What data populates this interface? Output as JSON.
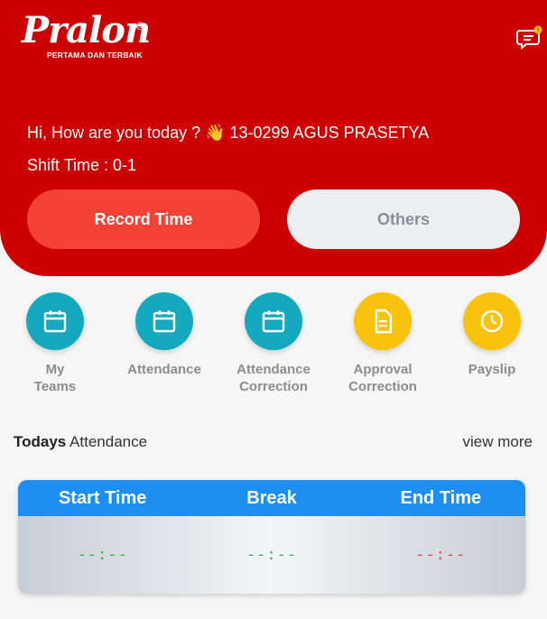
{
  "brand": {
    "name": "Pralon",
    "registered": "®",
    "tagline": "PERTAMA DAN TERBAIK"
  },
  "header": {
    "greeting": "Hi, How are you today ? 👋 13-0299 AGUS PRASETYA",
    "shift": "Shift Time : 0-1",
    "buttons": {
      "record_time": "Record Time",
      "others": "Others"
    },
    "notification_icon": "chat-bubble-icon"
  },
  "menu": [
    {
      "label": "My\nTeams",
      "icon": "calendar-icon",
      "color": "#14a9bf"
    },
    {
      "label": "Attendance",
      "icon": "calendar-icon",
      "color": "#14a9bf"
    },
    {
      "label": "Attendance\nCorrection",
      "icon": "calendar-icon",
      "color": "#14a9bf"
    },
    {
      "label": "Approval\nCorrection",
      "icon": "document-icon",
      "color": "#f9c20c"
    },
    {
      "label": "Payslip",
      "icon": "clock-icon",
      "color": "#f9c20c"
    }
  ],
  "attendance": {
    "title_bold": "Todays",
    "title_rest": " Attendance",
    "view_more": "view more",
    "columns": [
      "Start Time",
      "Break",
      "End Time"
    ],
    "values": [
      "--:--",
      "--:--",
      "--:--"
    ]
  },
  "colors": {
    "header_red": "#cc0000",
    "record_btn": "#f44336",
    "table_head": "#1e8ef0"
  }
}
